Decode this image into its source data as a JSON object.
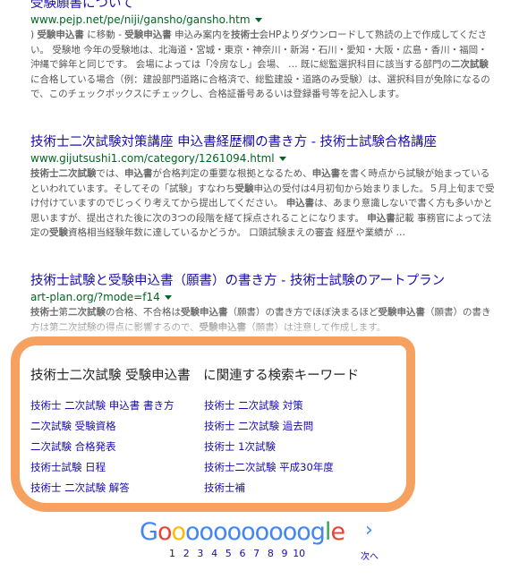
{
  "results": [
    {
      "title": "受験願書について",
      "url": "www.pejp.net/pe/niji/gansho/gansho.htm",
      "snippet_html": ") <b>受験申込書</b> に移動 - <b>受験申込書</b> 申込み案内を<b>技術士</b>会HPよりダウンロードして熟読の上で作成してください。 受験地 今年の受験地は、北海道・宮城・東京・神奈川・新潟・石川・愛知・大阪・広島・香川・福岡・沖縄で鉾年と同じです。 会場によっては「冷房なし」会場、 … 既に総監選択科目に該当する部門の<b>二次試験</b>に合格している場合（例：建設部門道路に合格済で、総監建設・道路のみ受験）は、選択科目が免除になるので、このチェックボックスにチェックし、合格証番号あるいは登録番号等を記入します。"
    },
    {
      "title": "技術士二次試験対策講座 申込書経歴欄の書き方 - 技術士試験合格講座",
      "url": "www.gijutsushi1.com/category/1261094.html",
      "snippet_html": "<b>技術士二次試験</b>では、<b>申込書</b>が合格判定の重要な根拠となるため、<b>申込書</b>を書く時点から試験が始まっているといわれています。そしてその「試験」すなわち<b>受験</b>申込の受付は4月初旬から始まりました。５月上旬まで受け付けていますのでじっくり考えてから提出してください。 <b>申込書</b>は、あまり意識しないで書く方も多いかと思いますが、提出された後に次の3つの段階を経て採点されることになります。 <b>申込書</b>記載 事務官によって法定の<b>受験</b>資格相当経験年数に達しているかどうか。 口頭試験まえの審査 経歴や業績が …"
    },
    {
      "title": "技術士試験と受験申込書（願書）の書き方 - 技術士試験のアートプラン",
      "url": "art-plan.org/?mode=f14",
      "snippet_html": "<b>技術士</b>第<b>二次試験</b>の合格、不合格は<b>受験申込書</b>（願書）の書き方でほぼ決まるほど<b>受験申込書</b>（願書）の書き方は第二次試験の得点に影響するので、<b>受験申込書</b>（願書）は注意して作成します。"
    }
  ],
  "related": {
    "title": "技術士二次試験 受験申込書　に関連する検索キーワード",
    "links": [
      "技術士 二次試験 申込書 書き方",
      "二次試験 受験資格",
      "二次試験 合格発表",
      "技術士試験 日程",
      "技術士 二次試験 解答",
      "技術士 二次試験 対策",
      "技術士 二次試験 過去問",
      "技術士 1次試験",
      "技術士二次試験 平成30年度",
      "技術士補"
    ]
  },
  "pagination": {
    "logo_letters": [
      "G",
      "o",
      "o",
      "o",
      "o",
      "o",
      "o",
      "o",
      "o",
      "o",
      "o",
      "o",
      "g",
      "l",
      "e"
    ],
    "logo_colors": [
      "#4285f4",
      "#ea4335",
      "#fbbc05",
      "#4285f4",
      "#4285f4",
      "#4285f4",
      "#4285f4",
      "#4285f4",
      "#4285f4",
      "#4285f4",
      "#4285f4",
      "#4285f4",
      "#4285f4",
      "#34a853",
      "#ea4335"
    ],
    "pages": [
      "1",
      "2",
      "3",
      "4",
      "5",
      "6",
      "7",
      "8",
      "9",
      "10"
    ],
    "current_page": "1",
    "next_arrow": "›",
    "next_label": "次へ"
  },
  "colors": {
    "link": "#1a0dab",
    "url": "#006621",
    "snippet": "#545454",
    "highlight": "#f7a160"
  }
}
